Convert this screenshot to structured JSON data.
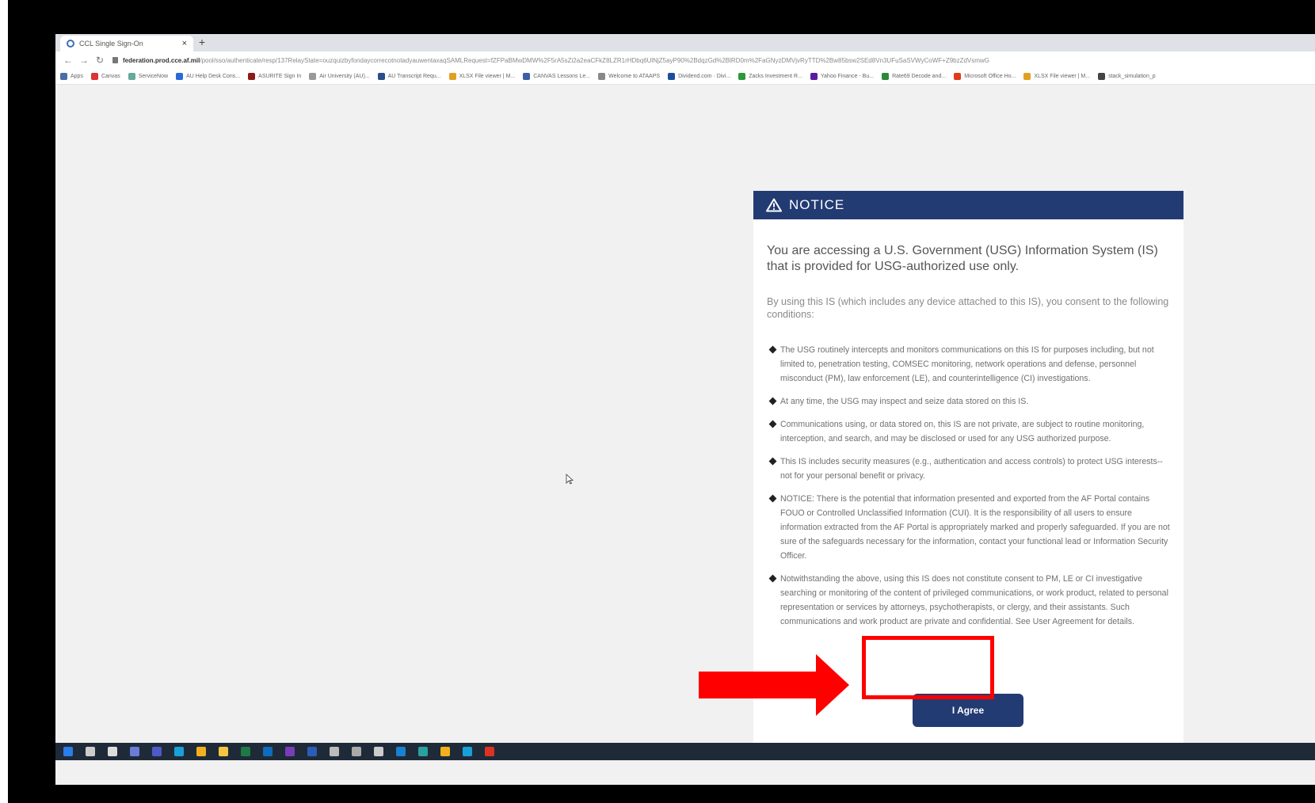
{
  "browser": {
    "tab_title": "CCL Single Sign-On",
    "tab_close": "×",
    "new_tab": "+",
    "url_domain": "federation.prod.cce.af.mil",
    "url_path": "/pool/sso/authenticate/resp/137RelayState=ouzquizbyfondaycorrecotnotadyauwentaxaqSAMLRequest=fZFPaBMwDMW%2F5rA5sZi2a2eaCFkZ8LZR1rHDbq6UlNjZ5ayP90%2BdqzGd%2BlRD0m%2FaGNyzDMVjvRyTTD%2Bw85bsw2SEd8Vn3UFuSaSVWyCoWF+Z9bzZdVsmwG",
    "bookmarks": [
      {
        "label": "Apps",
        "color": "#4a6fa5"
      },
      {
        "label": "Canvas",
        "color": "#d33"
      },
      {
        "label": "ServiceNow",
        "color": "#6a9"
      },
      {
        "label": "AU Help Desk Cons...",
        "color": "#2a6ad8"
      },
      {
        "label": "ASURITE Sign In",
        "color": "#8b1c1c"
      },
      {
        "label": "Air University (AU)...",
        "color": "#999"
      },
      {
        "label": "AU Transcript Requ...",
        "color": "#2a4f8a"
      },
      {
        "label": "XLSX File viewer | M...",
        "color": "#e0a020"
      },
      {
        "label": "CANVAS Lessons Le...",
        "color": "#3c5fa8"
      },
      {
        "label": "Welcome to ATAAPS",
        "color": "#888"
      },
      {
        "label": "Dividend.com · Divi...",
        "color": "#1b4f9c"
      },
      {
        "label": "Zacks Investment R...",
        "color": "#2a9a3a"
      },
      {
        "label": "Yahoo Finance - Bu...",
        "color": "#5b1aa0"
      },
      {
        "label": "Rate69 Decode and...",
        "color": "#2a8a3a"
      },
      {
        "label": "Microsoft Office Ho...",
        "color": "#e03a1a"
      },
      {
        "label": "XLSX File viewer | M...",
        "color": "#e0a020"
      },
      {
        "label": "stack_simulation_p",
        "color": "#444"
      }
    ]
  },
  "notice": {
    "title": "NOTICE",
    "lead": "You are accessing a U.S. Government (USG) Information System (IS) that is provided for USG-authorized use only.",
    "intro": "By using this IS (which includes any device attached to this IS), you consent to the following conditions:",
    "conditions": [
      "The USG routinely intercepts and monitors communications on this IS for purposes including, but not limited to, penetration testing, COMSEC monitoring, network operations and defense, personnel misconduct (PM), law enforcement (LE), and counterintelligence (CI) investigations.",
      "At any time, the USG may inspect and seize data stored on this IS.",
      "Communications using, or data stored on, this IS are not private, are subject to routine monitoring, interception, and search, and may be disclosed or used for any USG authorized purpose.",
      "This IS includes security measures (e.g., authentication and access controls) to protect USG interests--not for your personal benefit or privacy.",
      "NOTICE: There is the potential that information presented and exported from the AF Portal contains FOUO or Controlled Unclassified Information (CUI). It is the responsibility of all users to ensure information extracted from the AF Portal is appropriately marked and properly safeguarded. If you are not sure of the safeguards necessary for the information, contact your functional lead or Information Security Officer.",
      "Notwithstanding the above, using this IS does not constitute consent to PM, LE or CI investigative searching or monitoring of the content of privileged communications, or work product, related to personal representation or services by attorneys, psychotherapists, or clergy, and their assistants. Such communications and work product are private and confidential. See User Agreement for details."
    ],
    "agree_label": "I Agree"
  },
  "colors": {
    "notice_header": "#233b73",
    "agree_button": "#233b73",
    "annotation_red": "#ff0000"
  },
  "taskbar_icons": [
    "windows-icon",
    "search-icon",
    "task-view-icon",
    "chat-icon",
    "teams-icon",
    "edge-icon",
    "chrome-icon",
    "file-explorer-icon",
    "excel-icon",
    "outlook-icon",
    "onenote-icon",
    "word-icon",
    "notepad-icon",
    "calculator-icon",
    "settings-icon",
    "mail-icon",
    "photos-icon",
    "chrome-icon",
    "edge-icon",
    "acrobat-icon"
  ]
}
